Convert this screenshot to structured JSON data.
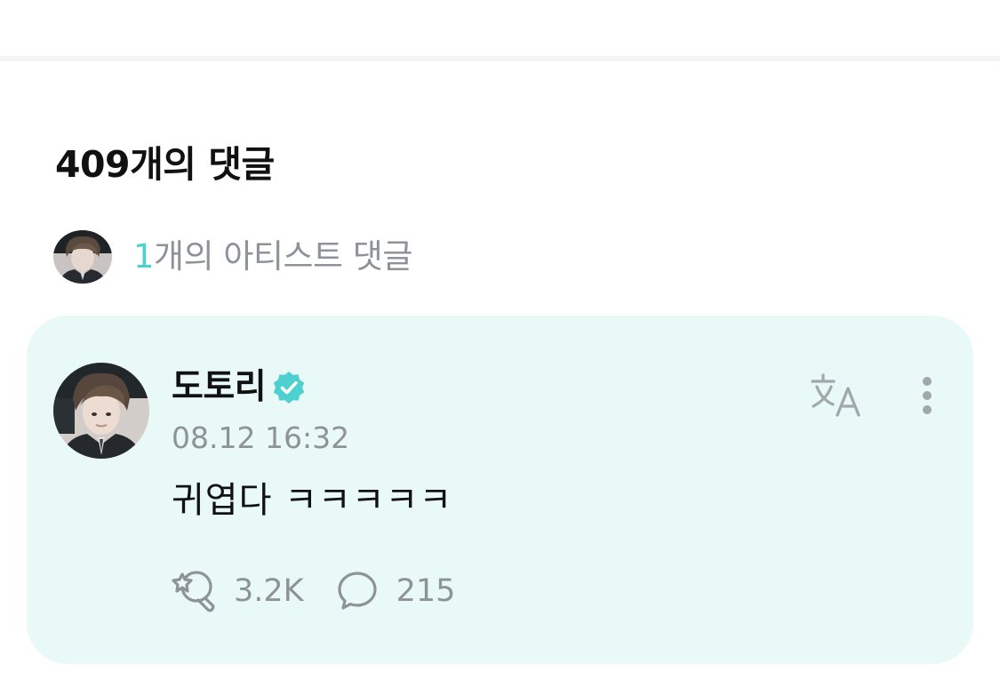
{
  "comments": {
    "total_title": "409개의 댓글"
  },
  "artist_summary": {
    "count": "1",
    "label": "개의 아티스트 댓글"
  },
  "comment": {
    "author": "도토리",
    "timestamp": "08.12 16:32",
    "body": "귀엽다  ㅋㅋㅋㅋㅋ",
    "likes": "3.2K",
    "replies": "215",
    "verified": true
  },
  "colors": {
    "accent": "#4fd0d0",
    "card_background": "#e9f9f7",
    "muted_text": "#8e9399",
    "icon_gray": "#a0a8ae"
  },
  "icons": {
    "verified": "verified-badge-icon",
    "translate": "translate-icon",
    "more": "more-vertical-icon",
    "like": "cheer-like-icon",
    "reply": "reply-bubble-icon"
  }
}
